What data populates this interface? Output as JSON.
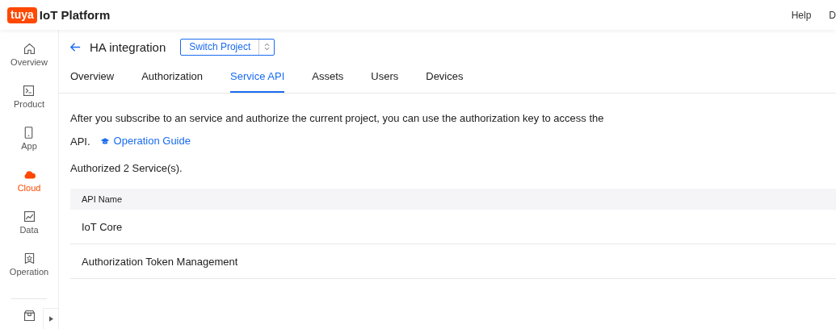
{
  "header": {
    "logo_badge": "tuya",
    "title": "IoT Platform",
    "links": [
      "Help",
      "D"
    ]
  },
  "sidebar": {
    "items": [
      {
        "label": "Overview",
        "selected": false
      },
      {
        "label": "Product",
        "selected": false
      },
      {
        "label": "App",
        "selected": false
      },
      {
        "label": "Cloud",
        "selected": true
      },
      {
        "label": "Data",
        "selected": false
      },
      {
        "label": "Operation",
        "selected": false
      }
    ]
  },
  "project": {
    "title": "HA integration",
    "switch_button": "Switch Project"
  },
  "tabs": [
    {
      "label": "Overview",
      "selected": false
    },
    {
      "label": "Authorization",
      "selected": false
    },
    {
      "label": "Service API",
      "selected": true
    },
    {
      "label": "Assets",
      "selected": false
    },
    {
      "label": "Users",
      "selected": false
    },
    {
      "label": "Devices",
      "selected": false
    }
  ],
  "intro": {
    "text": "After you subscribe to an service and authorize the current project, you can use the authorization key to access the API.",
    "link": "Operation Guide"
  },
  "summary": "Authorized 2 Service(s).",
  "table": {
    "columns": [
      "API Name"
    ],
    "rows": [
      [
        "IoT Core"
      ],
      [
        "Authorization Token Management"
      ]
    ]
  }
}
